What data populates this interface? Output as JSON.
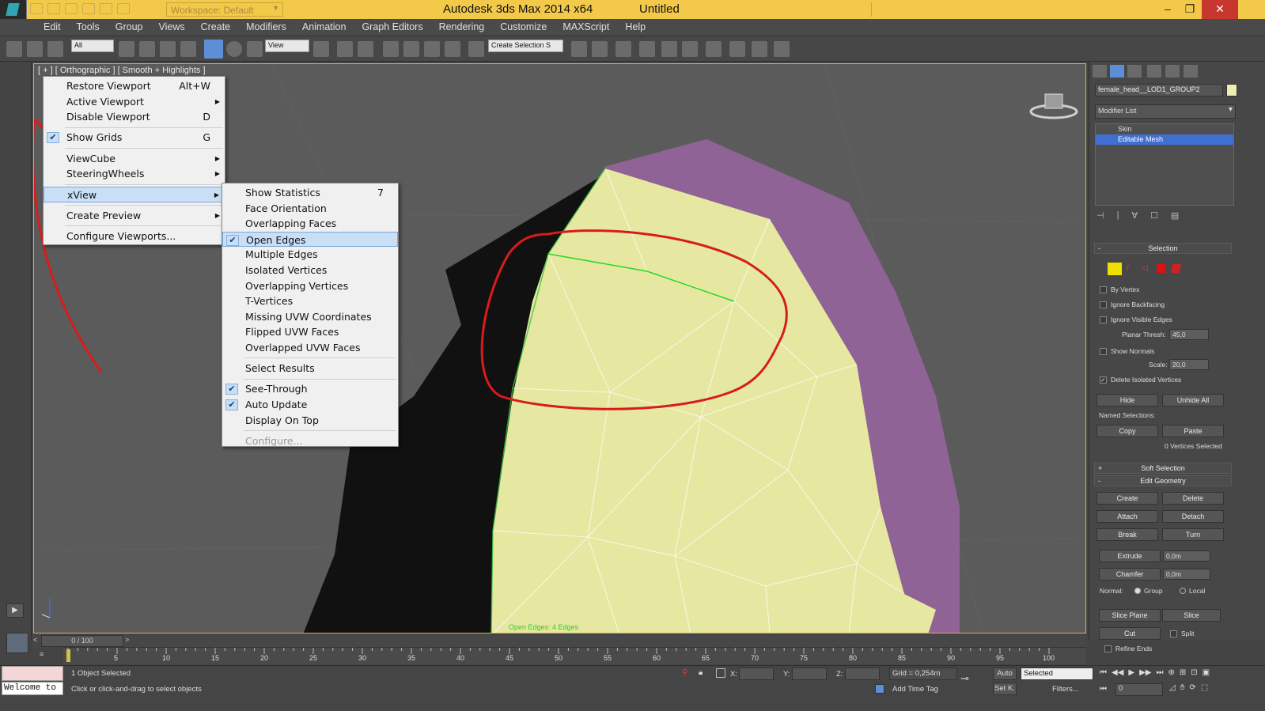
{
  "titlebar": {
    "workspace": "Workspace: Default",
    "app_title": "Autodesk 3ds Max  2014 x64",
    "doc_title": "Untitled",
    "minimize": "–",
    "maximize": "❐",
    "close": "✕"
  },
  "menubar": [
    "Edit",
    "Tools",
    "Group",
    "Views",
    "Create",
    "Modifiers",
    "Animation",
    "Graph Editors",
    "Rendering",
    "Customize",
    "MAXScript",
    "Help"
  ],
  "toolbar": {
    "filter": "All",
    "ref_coord": "View",
    "selection_set": "Create Selection S"
  },
  "viewport": {
    "label": "[ + ] [ Orthographic ] [ Smooth + Highlights ]",
    "stats_overlay": "Open Edges: 4 Edges"
  },
  "colors": {
    "title_bg": "#f3c94a",
    "mesh": "#e6e8a2",
    "purple": "#8f6396",
    "annotation": "#d81c1c",
    "selection_highlight": "#3f6fd1"
  },
  "viewport_menu": [
    {
      "label": "Restore Viewport",
      "shortcut": "Alt+W"
    },
    {
      "label": "Active Viewport",
      "submenu": true
    },
    {
      "label": "Disable Viewport",
      "shortcut": "D"
    },
    {
      "sep": true
    },
    {
      "label": "Show Grids",
      "shortcut": "G",
      "checked": true
    },
    {
      "sep": true
    },
    {
      "label": "ViewCube",
      "submenu": true
    },
    {
      "label": "SteeringWheels",
      "submenu": true
    },
    {
      "sep": true
    },
    {
      "label": "xView",
      "submenu": true,
      "highlighted": true
    },
    {
      "sep": true
    },
    {
      "label": "Create Preview",
      "submenu": true
    },
    {
      "sep": true
    },
    {
      "label": "Configure Viewports..."
    }
  ],
  "xview_menu": [
    {
      "label": "Show Statistics",
      "shortcut": "7"
    },
    {
      "label": "Face Orientation"
    },
    {
      "label": "Overlapping Faces"
    },
    {
      "label": "Open Edges",
      "checked": true,
      "highlighted": true
    },
    {
      "label": "Multiple Edges"
    },
    {
      "label": "Isolated Vertices"
    },
    {
      "label": "Overlapping Vertices"
    },
    {
      "label": "T-Vertices"
    },
    {
      "label": "Missing UVW Coordinates"
    },
    {
      "label": "Flipped UVW Faces"
    },
    {
      "label": "Overlapped UVW Faces"
    },
    {
      "sep": true
    },
    {
      "label": "Select Results"
    },
    {
      "sep": true
    },
    {
      "label": "See-Through",
      "checked": true
    },
    {
      "label": "Auto Update",
      "checked": true
    },
    {
      "label": "Display On Top"
    },
    {
      "sep": true
    },
    {
      "label": "Configure...",
      "disabled": true
    }
  ],
  "command_panel": {
    "object_name": "female_head__LOD1_GROUP2",
    "modifier_list": "Modifier List",
    "stack": [
      "Skin",
      "Editable Mesh"
    ],
    "selection": {
      "title": "Selection",
      "by_vertex": "By Vertex",
      "ignore_backfacing": "Ignore Backfacing",
      "ignore_visible_edges": "Ignore Visible Edges",
      "planar_thresh_label": "Planar Thresh:",
      "planar_thresh": "45,0",
      "show_normals": "Show Normals",
      "scale_label": "Scale:",
      "scale": "20,0",
      "delete_isolated": "Delete Isolated Vertices",
      "hide": "Hide",
      "unhide_all": "Unhide All",
      "named_selections": "Named Selections:",
      "copy": "Copy",
      "paste": "Paste",
      "status": "0 Vertices Selected"
    },
    "soft_selection": "Soft Selection",
    "edit_geometry": {
      "title": "Edit Geometry",
      "create": "Create",
      "delete": "Delete",
      "attach": "Attach",
      "detach": "Detach",
      "break": "Break",
      "turn": "Turn",
      "extrude": "Extrude",
      "extrude_val": "0,0m",
      "chamfer": "Chamfer",
      "chamfer_val": "0,0m",
      "normal_label": "Normal:",
      "group": "Group",
      "local": "Local",
      "slice_plane": "Slice Plane",
      "slice": "Slice",
      "cut": "Cut",
      "split": "Split",
      "refine_ends": "Refine Ends"
    }
  },
  "timeline": {
    "frame": "0 / 100",
    "ticks": [
      "5",
      "10",
      "15",
      "20",
      "25",
      "30",
      "35",
      "40",
      "45",
      "50",
      "55",
      "60",
      "65",
      "70",
      "75",
      "80",
      "85",
      "90",
      "95",
      "100"
    ]
  },
  "status": {
    "welcome": "Welcome to",
    "objects_selected": "1 Object Selected",
    "prompt": "Click or click-and-drag to select objects",
    "x_label": "X:",
    "y_label": "Y:",
    "z_label": "Z:",
    "grid": "Grid = 0,254m",
    "add_time_tag": "Add Time Tag",
    "auto": "Auto",
    "set_key": "Set K.",
    "key_mode": "Selected",
    "filters": "Filters...",
    "current_frame": "0"
  }
}
